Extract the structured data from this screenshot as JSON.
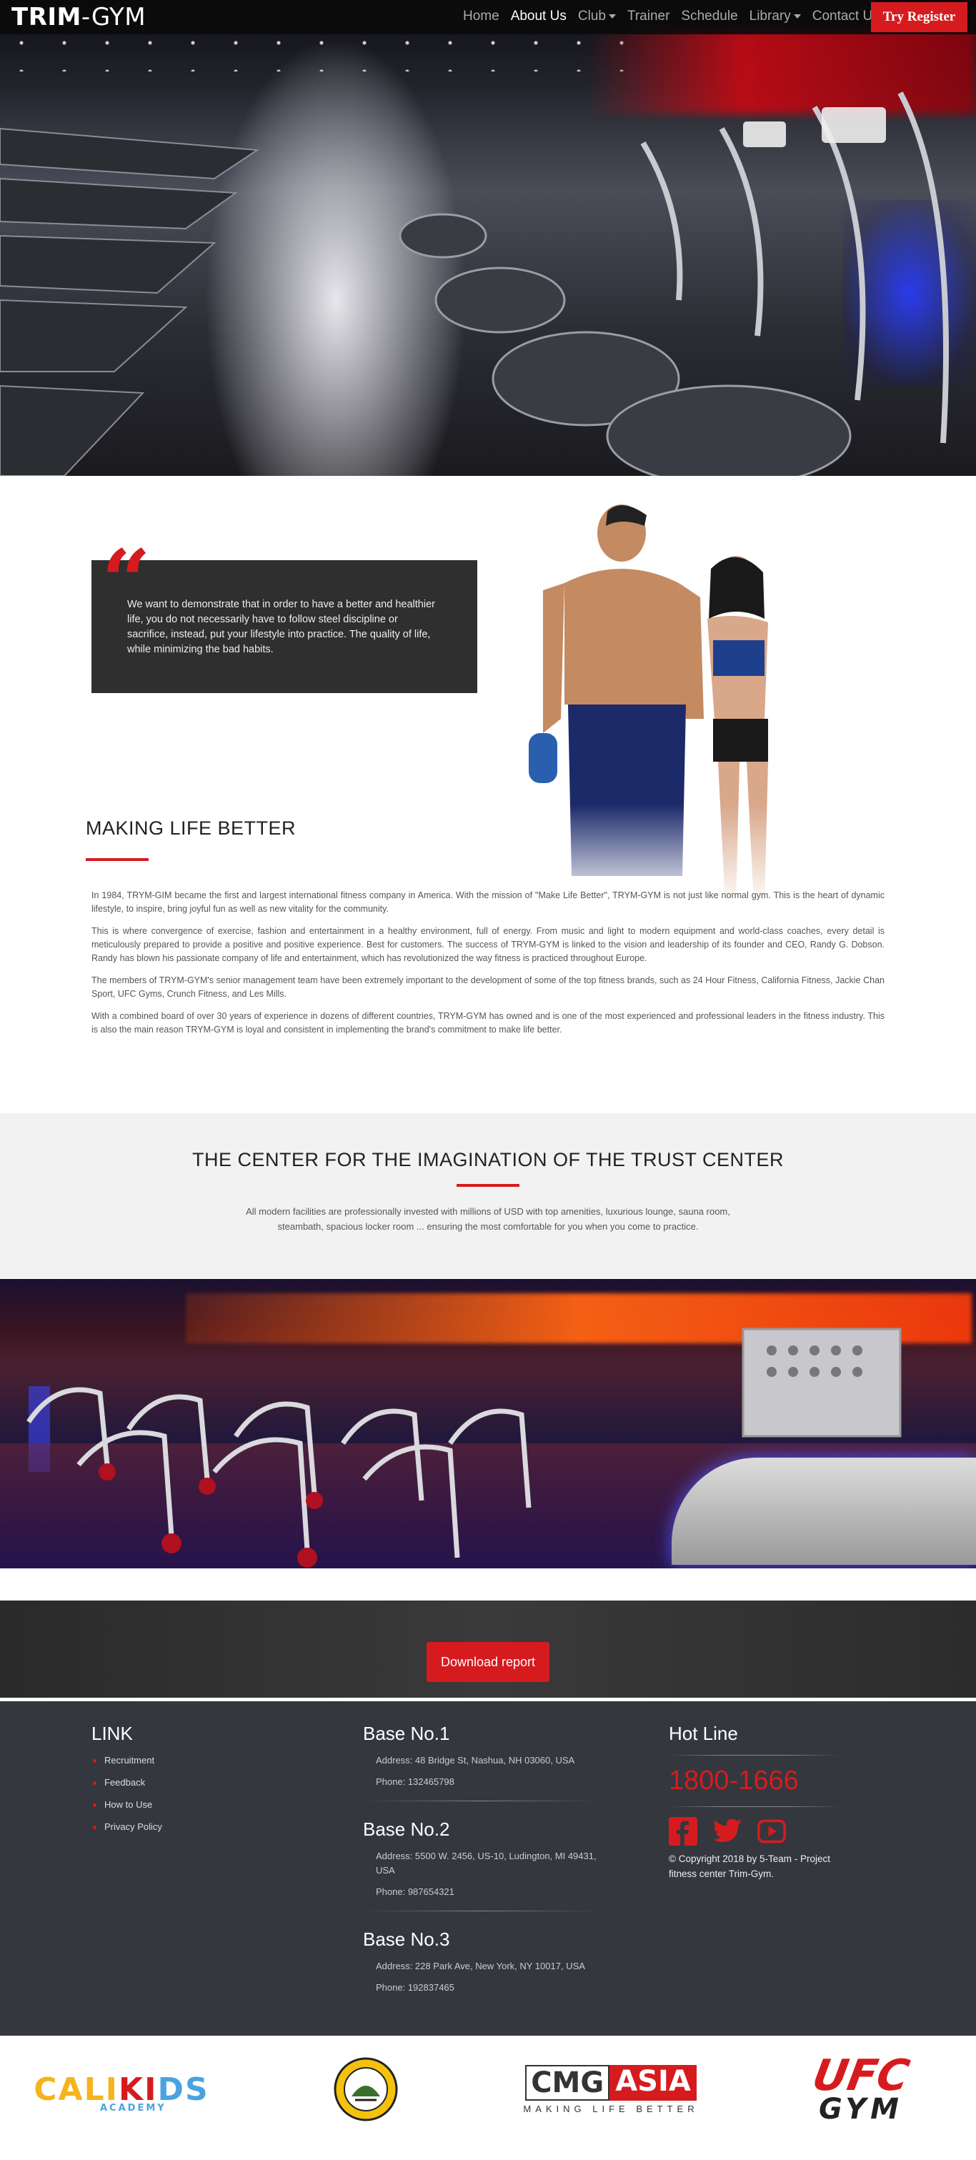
{
  "navbar": {
    "brand_bold": "TRIM",
    "brand_light": "-GYM",
    "items": [
      {
        "label": "Home",
        "active": false,
        "dropdown": false
      },
      {
        "label": "About Us",
        "active": true,
        "dropdown": false
      },
      {
        "label": "Club",
        "active": false,
        "dropdown": true
      },
      {
        "label": "Trainer",
        "active": false,
        "dropdown": false
      },
      {
        "label": "Schedule",
        "active": false,
        "dropdown": false
      },
      {
        "label": "Library",
        "active": false,
        "dropdown": true
      },
      {
        "label": "Contact Us",
        "active": false,
        "dropdown": false
      }
    ],
    "cta_label": "Try Register"
  },
  "about": {
    "quote": "We want to demonstrate that in order to have a better and healthier life, you do not necessarily have to follow steel discipline or sacrifice, instead, put your lifestyle into practice. The quality of life, while minimizing the bad habits.",
    "title": "MAKING LIFE BETTER",
    "paragraphs": [
      "In 1984, TRYM-GIM became the first and largest international fitness company in America. With the mission of \"Make Life Better\", TRYM-GYM is not just like normal gym. This is the heart of dynamic lifestyle, to inspire, bring joyful fun as well as new vitality for the community.",
      "This is where convergence of exercise, fashion and entertainment in a healthy environment, full of energy. From music and light to modern equipment and world-class coaches, every detail is meticulously prepared to provide a positive and positive experience. Best for customers. The success of TRYM-GYM is linked to the vision and leadership of its founder and CEO, Randy G. Dobson. Randy has blown his passionate company of life and entertainment, which has revolutionized the way fitness is practiced throughout Europe.",
      "The members of TRYM-GYM's senior management team have been extremely important to the development of some of the top fitness brands, such as 24 Hour Fitness, California Fitness, Jackie Chan Sport, UFC Gyms, Crunch Fitness, and Les Mills.",
      "With a combined board of over 30 years of experience in dozens of different countries, TRYM-GYM has owned and is one of the most experienced and professional leaders in the fitness industry. This is also the main reason TRYM-GYM is loyal and consistent in implementing the brand's commitment to make life better."
    ]
  },
  "center": {
    "title": "THE CENTER FOR THE IMAGINATION OF THE TRUST CENTER",
    "text": "All modern facilities are professionally invested with millions of USD with top amenities, luxurious lounge, sauna room, steambath, spacious locker room ... ensuring the most comfortable for you when you come to practice."
  },
  "download": {
    "label": "Download report"
  },
  "footer": {
    "link_title": "LINK",
    "links": [
      "Recruitment",
      "Feedback",
      "How to Use",
      "Privacy Policy"
    ],
    "bases": [
      {
        "title": "Base No.1",
        "address": "Address: 48 Bridge St, Nashua, NH 03060, USA",
        "phone": "Phone: 132465798"
      },
      {
        "title": "Base No.2",
        "address": "Address: 5500 W. 2456, US-10, Ludington, MI 49431, USA",
        "phone": "Phone: 987654321"
      },
      {
        "title": "Base No.3",
        "address": "Address: 228 Park Ave, New York, NY 10017, USA",
        "phone": "Phone: 192837465"
      }
    ],
    "hotline_title": "Hot Line",
    "hotline_number": "1800-1666",
    "copyright": "© Copyright 2018 by 5-Team - Project fitness center Trim-Gym."
  },
  "partners": {
    "calikids": {
      "c1": "CALI",
      "c2": "KI",
      "c3": "DS",
      "sub": "ACADEMY"
    },
    "cmg": {
      "a": "CMG",
      "b": "ASIA",
      "tag": "MAKING LIFE BETTER"
    },
    "ufc": {
      "t1": "UFC",
      "t2": "GYM"
    }
  },
  "colors": {
    "accent": "#d61b1f",
    "footer_bg": "#34373d",
    "navbar_bg": "#0a0a0a"
  }
}
